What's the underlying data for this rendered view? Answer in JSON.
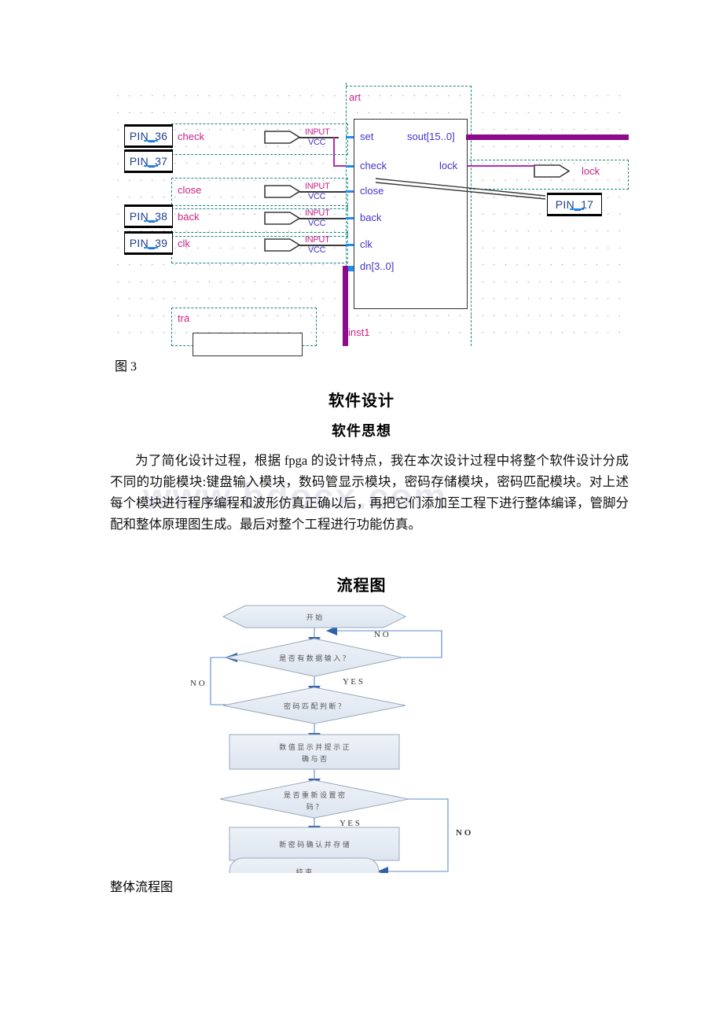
{
  "document": {
    "figure3_caption": "图 3",
    "heading_major": "软件设计",
    "heading_minor": "软件思想",
    "paragraph": "为了简化设计过程，根据 fpga 的设计特点，我在本次设计过程中将整个软件设计分成不同的功能模块:键盘输入模块，数码管显示模块，密码存储模块，密码匹配模块。对上述每个模块进行程序编程和波形仿真正确以后，再把它们添加至工程下进行整体编译，管脚分配和整体原理图生成。最后对整个工程进行功能仿真。",
    "watermark": "www.bdocx.com",
    "flowchart_heading": "流程图",
    "flowchart_caption": "整体流程图"
  },
  "schematic": {
    "top_tag": "art",
    "bottom_tag": "tra",
    "instance_label": "inst1",
    "pins": [
      {
        "name": "PIN_36"
      },
      {
        "name": "PIN_37"
      },
      {
        "name": "PIN_38"
      },
      {
        "name": "PIN_39"
      },
      {
        "name": "PIN_17"
      }
    ],
    "signal_names": [
      "check",
      "close",
      "back",
      "clk",
      "lock"
    ],
    "input_symbols": [
      {
        "type": "INPUT",
        "power": "VCC"
      },
      {
        "type": "INPUT",
        "power": "VCC"
      },
      {
        "type": "INPUT",
        "power": "VCC"
      },
      {
        "type": "INPUT",
        "power": "VCC"
      }
    ],
    "output_symbol": {
      "type": "OUTPUT"
    },
    "module_inputs": [
      "set",
      "check",
      "close",
      "back",
      "clk",
      "dn[3..0]"
    ],
    "module_outputs": [
      "sout[15..0]",
      "lock"
    ],
    "colors": {
      "wire_blue": "#1f8ef1",
      "wire_purple": "#b22ab2",
      "bus_purple": "#8c0a8c",
      "label_magenta": "#cc2288",
      "port_blue": "#4433cc",
      "selection_teal": "#17867f"
    }
  },
  "flowchart": {
    "nodes": [
      {
        "id": "start",
        "shape": "hexagon",
        "label": "开  始"
      },
      {
        "id": "has_data",
        "shape": "diamond",
        "label": "是 否 有 数 据 输 入 ？"
      },
      {
        "id": "match",
        "shape": "diamond",
        "label": "密 码 匹 配 判 断 ？"
      },
      {
        "id": "display",
        "shape": "rect",
        "label": "数 值 显 示 并 提 示 正",
        "label2": "确   与   否"
      },
      {
        "id": "reset",
        "shape": "diamond",
        "label": "是 否 重 新 设 置 密",
        "label2": "码  ？"
      },
      {
        "id": "store",
        "shape": "rect",
        "label": "新 密 码 确 认 并 存 储"
      },
      {
        "id": "end",
        "shape": "oval",
        "label": "结   束"
      }
    ],
    "edge_labels": [
      {
        "id": "no_top",
        "text": "N  O"
      },
      {
        "id": "yes_data",
        "text": "Y E S"
      },
      {
        "id": "no_left",
        "text": "N  O"
      },
      {
        "id": "yes_reset",
        "text": "Y E S"
      },
      {
        "id": "no_right",
        "text": "N  O"
      }
    ],
    "colors": {
      "fill": "#e5ebf3",
      "stroke": "#9aa8bc",
      "arrow": "#2e61a8",
      "line": "#5b8cc8"
    }
  }
}
